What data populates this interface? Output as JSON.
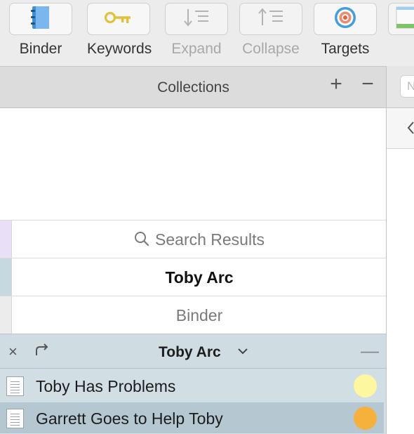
{
  "toolbar": {
    "items": [
      {
        "label": "Binder",
        "icon": "binder-notebook-icon",
        "enabled": true
      },
      {
        "label": "Keywords",
        "icon": "key-icon",
        "enabled": true
      },
      {
        "label": "Expand",
        "icon": "expand-arrow-icon",
        "enabled": false
      },
      {
        "label": "Collapse",
        "icon": "collapse-arrow-icon",
        "enabled": false
      },
      {
        "label": "Targets",
        "icon": "target-icon",
        "enabled": true
      }
    ]
  },
  "collections": {
    "title": "Collections",
    "add_symbol": "+",
    "remove_symbol": "−",
    "tabs": [
      {
        "label": "Search Results",
        "icon": "search-icon",
        "color": "#e9e0f8",
        "active": false
      },
      {
        "label": "Toby Arc",
        "color": "#c7d9e0",
        "active": true
      },
      {
        "label": "Binder",
        "color": "#ececec",
        "active": false
      }
    ]
  },
  "panel": {
    "close_symbol": "×",
    "title": "Toby Arc",
    "minus_symbol": "—"
  },
  "documents": [
    {
      "title": "Toby Has Problems",
      "label_color": "#fdf7a0",
      "selected": false
    },
    {
      "title": "Garrett Goes to Help Toby",
      "label_color": "#f5b13b",
      "selected": true
    }
  ],
  "right_panel": {
    "field_char": "N"
  },
  "colors": {
    "accent_panel": "#cfdde3",
    "selected_row": "#b5c8d1"
  }
}
